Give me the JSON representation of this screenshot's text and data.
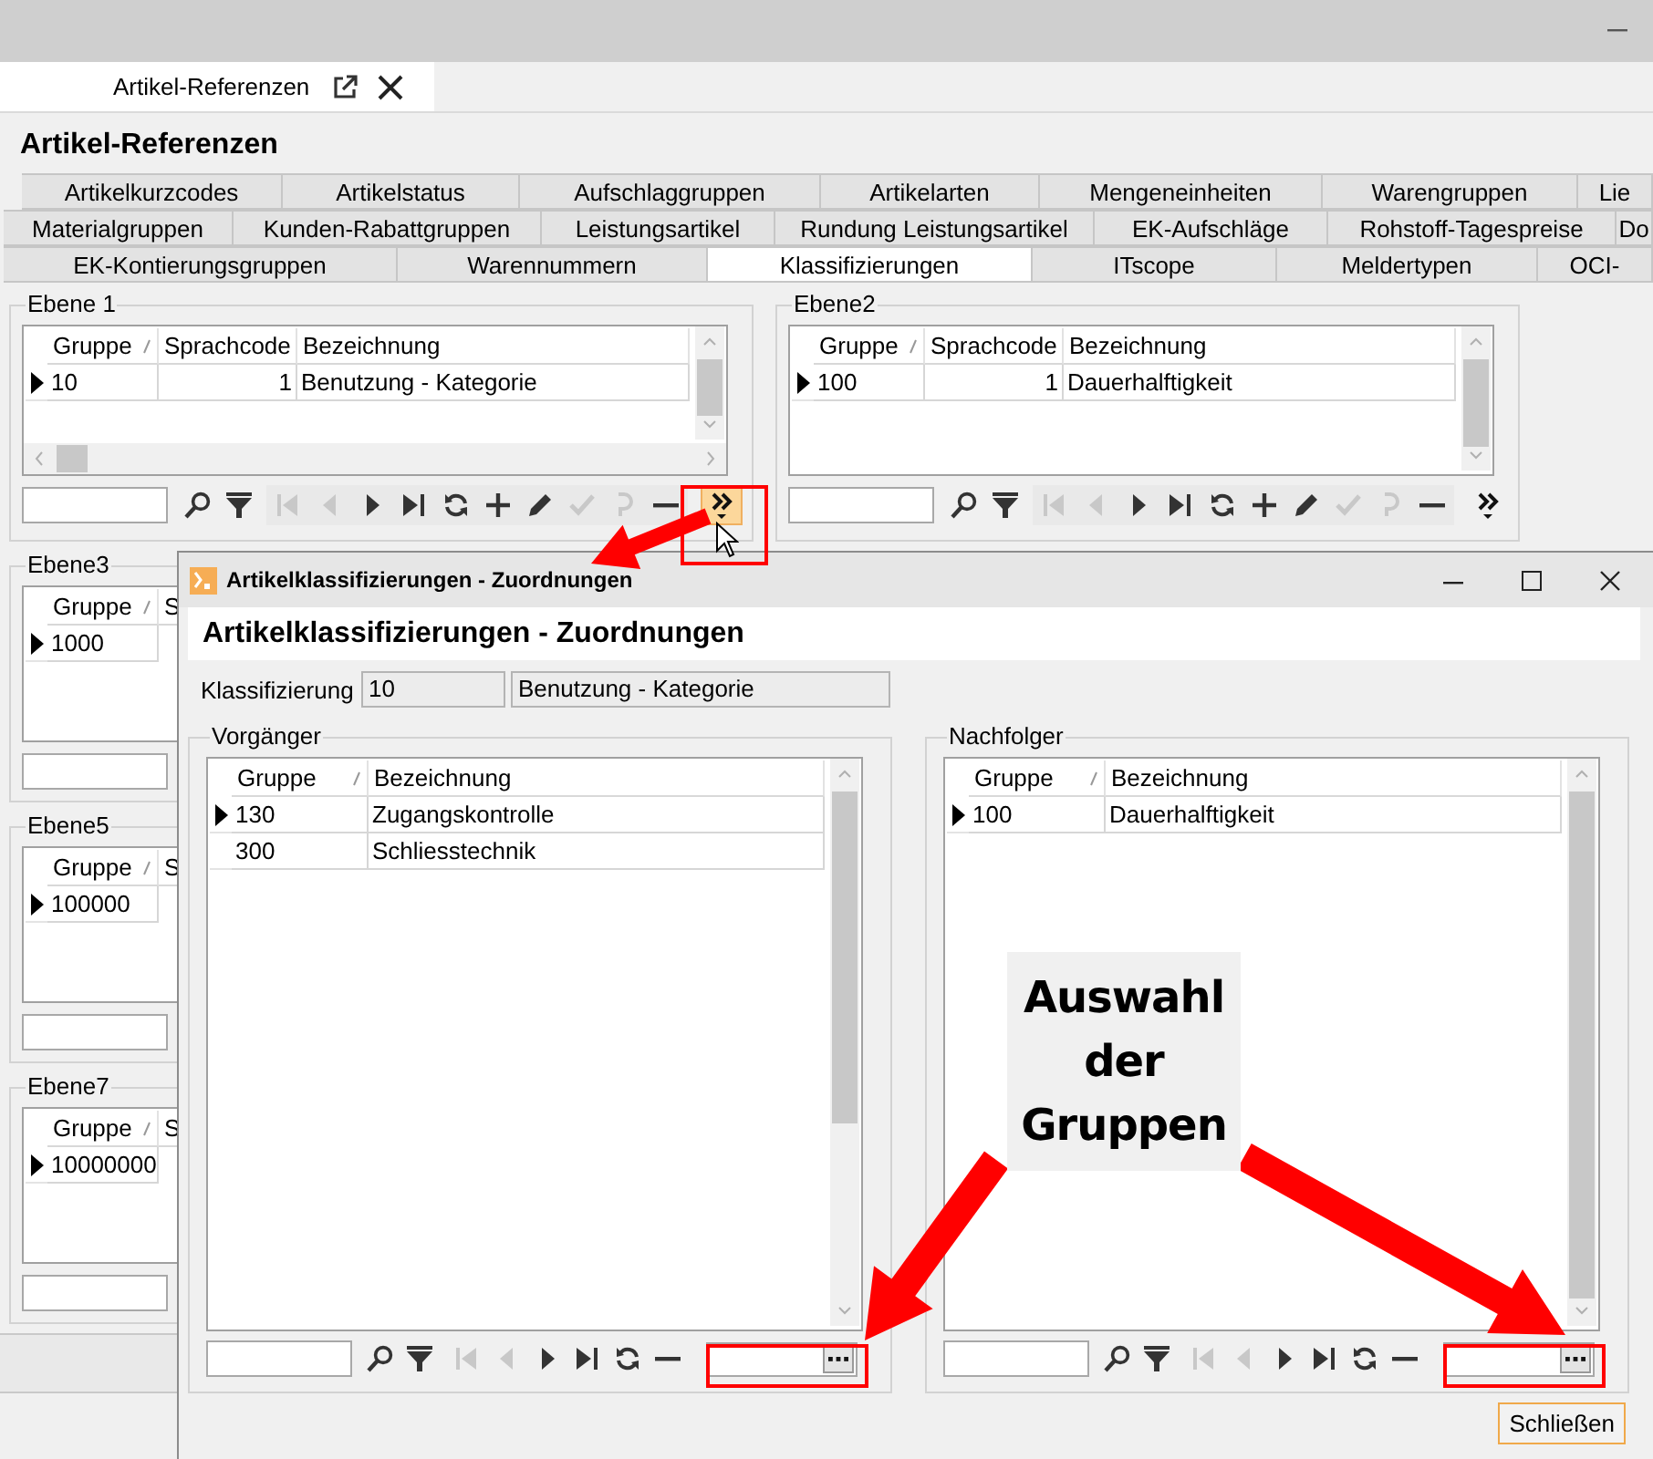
{
  "main_window": {
    "doc_tab": {
      "label": "Artikel-Referenzen",
      "selected": true
    },
    "heading": "Artikel-Referenzen"
  },
  "tab_rows": [
    {
      "tabs": [
        {
          "label": "Artikelkurzcodes",
          "selected": false
        },
        {
          "label": "Artikelstatus",
          "selected": false
        },
        {
          "label": "Aufschlaggruppen",
          "selected": false
        },
        {
          "label": "Artikelarten",
          "selected": false
        },
        {
          "label": "Mengeneinheiten",
          "selected": false
        },
        {
          "label": "Warengruppen",
          "selected": false
        },
        {
          "label": "Lie",
          "selected": false
        }
      ]
    },
    {
      "tabs": [
        {
          "label": "Materialgruppen",
          "selected": false
        },
        {
          "label": "Kunden-Rabattgruppen",
          "selected": false
        },
        {
          "label": "Leistungsartikel",
          "selected": false
        },
        {
          "label": "Rundung Leistungsartikel",
          "selected": false
        },
        {
          "label": "EK-Aufschläge",
          "selected": false
        },
        {
          "label": "Rohstoff-Tagespreise",
          "selected": false
        },
        {
          "label": "Do",
          "selected": false
        }
      ]
    },
    {
      "tabs": [
        {
          "label": "EK-Kontierungsgruppen",
          "selected": false
        },
        {
          "label": "Warennummern",
          "selected": false
        },
        {
          "label": "Klassifizierungen",
          "selected": true
        },
        {
          "label": "ITscope",
          "selected": false
        },
        {
          "label": "Meldertypen",
          "selected": false
        },
        {
          "label": "OCI-",
          "selected": false
        }
      ]
    }
  ],
  "panels": [
    {
      "title": "Ebene 1",
      "columns": [
        {
          "label": "Gruppe",
          "sorted": true
        },
        {
          "label": "Sprachcode",
          "sorted": false
        },
        {
          "label": "Bezeichnung",
          "sorted": false
        }
      ],
      "rows": [
        {
          "current": true,
          "cells": [
            "10",
            "1",
            "Benutzung - Kategorie"
          ]
        }
      ],
      "tools": [
        {
          "kind": "search",
          "disabled": false
        },
        {
          "kind": "filter",
          "disabled": false
        },
        {
          "kind": "first",
          "disabled": true
        },
        {
          "kind": "prev",
          "disabled": true
        },
        {
          "kind": "next",
          "disabled": false
        },
        {
          "kind": "last",
          "disabled": false
        },
        {
          "kind": "refresh",
          "disabled": false
        },
        {
          "kind": "add",
          "disabled": false
        },
        {
          "kind": "edit",
          "disabled": false
        },
        {
          "kind": "confirm",
          "disabled": true
        },
        {
          "kind": "undo",
          "disabled": true
        },
        {
          "kind": "remove",
          "disabled": false
        },
        {
          "kind": "more",
          "disabled": false,
          "highlighted": true
        }
      ]
    },
    {
      "title": "Ebene2",
      "columns": [
        {
          "label": "Gruppe",
          "sorted": true
        },
        {
          "label": "Sprachcode",
          "sorted": false
        },
        {
          "label": "Bezeichnung",
          "sorted": false
        }
      ],
      "rows": [
        {
          "current": true,
          "cells": [
            "100",
            "1",
            "Dauerhalftigkeit"
          ]
        }
      ],
      "tools": [
        {
          "kind": "search",
          "disabled": false
        },
        {
          "kind": "filter",
          "disabled": false
        },
        {
          "kind": "first",
          "disabled": true
        },
        {
          "kind": "prev",
          "disabled": true
        },
        {
          "kind": "next",
          "disabled": false
        },
        {
          "kind": "last",
          "disabled": false
        },
        {
          "kind": "refresh",
          "disabled": false
        },
        {
          "kind": "add",
          "disabled": false
        },
        {
          "kind": "edit",
          "disabled": false
        },
        {
          "kind": "confirm",
          "disabled": true
        },
        {
          "kind": "undo",
          "disabled": true
        },
        {
          "kind": "remove",
          "disabled": false
        },
        {
          "kind": "more",
          "disabled": false,
          "highlighted": false
        }
      ]
    },
    {
      "title": "Ebene3",
      "columns": [
        {
          "label": "Gruppe",
          "sorted": true
        },
        {
          "label": "S"
        }
      ],
      "rows": [
        {
          "current": true,
          "cells": [
            "1000"
          ]
        }
      ]
    },
    {
      "title": "Ebene5",
      "columns": [
        {
          "label": "Gruppe",
          "sorted": true
        },
        {
          "label": "S"
        }
      ],
      "rows": [
        {
          "current": true,
          "cells": [
            "100000"
          ]
        }
      ]
    },
    {
      "title": "Ebene7",
      "columns": [
        {
          "label": "Gruppe",
          "sorted": true
        },
        {
          "label": "S"
        }
      ],
      "rows": [
        {
          "current": true,
          "cells": [
            "10000000"
          ]
        }
      ]
    }
  ],
  "dialog": {
    "title": "Artikelklassifizierungen - Zuordnungen",
    "heading": "Artikelklassifizierungen - Zuordnungen",
    "classification": {
      "label": "Klassifizierung",
      "code": "10",
      "name": "Benutzung - Kategorie"
    },
    "panels": [
      {
        "title": "Vorgänger",
        "columns": [
          {
            "label": "Gruppe",
            "sorted": true
          },
          {
            "label": "Bezeichnung",
            "sorted": false
          }
        ],
        "rows": [
          {
            "current": true,
            "cells": [
              "130",
              "Zugangskontrolle"
            ]
          },
          {
            "current": false,
            "cells": [
              "300",
              "Schliesstechnik"
            ]
          }
        ],
        "tools": [
          {
            "kind": "search",
            "disabled": false
          },
          {
            "kind": "filter",
            "disabled": false
          },
          {
            "kind": "first",
            "disabled": true
          },
          {
            "kind": "prev",
            "disabled": true
          },
          {
            "kind": "next",
            "disabled": false
          },
          {
            "kind": "last",
            "disabled": false
          },
          {
            "kind": "refresh",
            "disabled": false
          },
          {
            "kind": "remove",
            "disabled": false
          },
          {
            "kind": "lookup",
            "disabled": false
          }
        ]
      },
      {
        "title": "Nachfolger",
        "columns": [
          {
            "label": "Gruppe",
            "sorted": true
          },
          {
            "label": "Bezeichnung",
            "sorted": false
          }
        ],
        "rows": [
          {
            "current": true,
            "cells": [
              "100",
              "Dauerhalftigkeit"
            ]
          }
        ],
        "tools": [
          {
            "kind": "search",
            "disabled": false
          },
          {
            "kind": "filter",
            "disabled": false
          },
          {
            "kind": "first",
            "disabled": true
          },
          {
            "kind": "prev",
            "disabled": true
          },
          {
            "kind": "next",
            "disabled": false
          },
          {
            "kind": "last",
            "disabled": false
          },
          {
            "kind": "refresh",
            "disabled": false
          },
          {
            "kind": "remove",
            "disabled": false
          },
          {
            "kind": "lookup",
            "disabled": false
          }
        ]
      }
    ],
    "close_button": "Schließen"
  },
  "annotation": {
    "text": "Auswahl der Gruppen"
  }
}
